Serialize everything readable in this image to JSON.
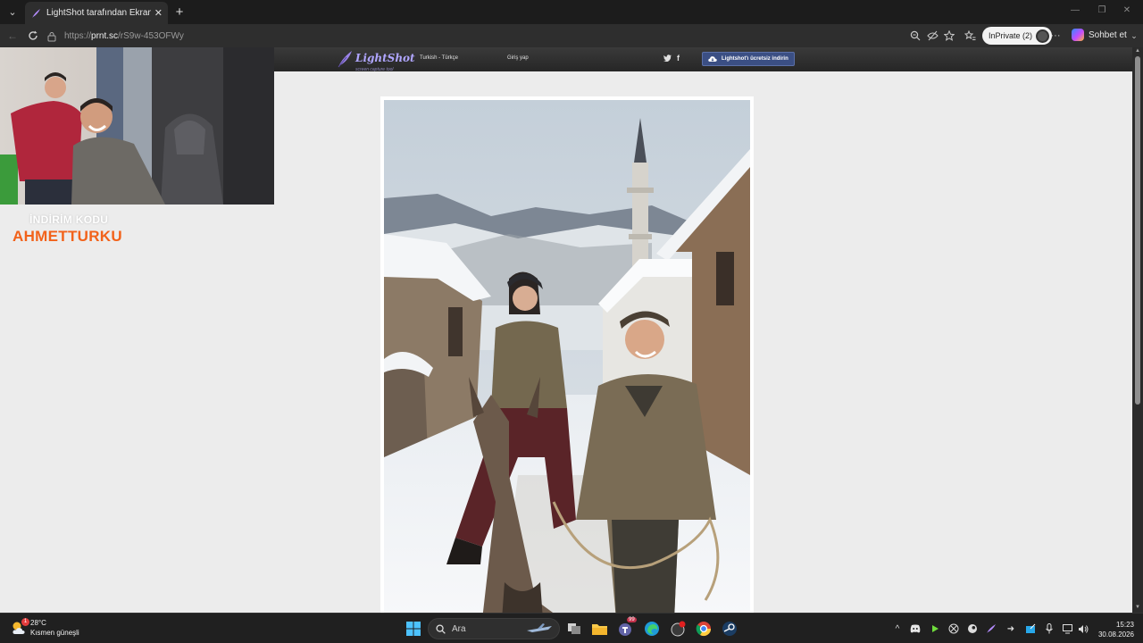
{
  "browser": {
    "tab": {
      "title": "LightShot tarafından Ekran Görünt",
      "close_glyph": "✕"
    },
    "new_tab_glyph": "+",
    "tab_list_glyph": "⌄",
    "window_controls": {
      "minimize": "—",
      "restore": "❐",
      "close": "✕"
    },
    "url": {
      "prefix": "https://",
      "domain": "prnt.sc",
      "path": "/rS9w-453OFWy"
    },
    "inprivate_label": "InPrivate (2)",
    "copilot_label": "Sohbet et",
    "more_glyph": "···"
  },
  "site": {
    "logo_text": "LightShot",
    "logo_subtitle": "screen capture tool",
    "language": "Turkish - Türkçe",
    "login": "Giriş yap",
    "twitter_glyph": "🐦",
    "facebook_glyph": "f",
    "download_button": "Lightshot'ı ücretsiz indirin"
  },
  "overlay": {
    "promo_label": "İNDİRİM KODU",
    "promo_code": "AHMETTURKU"
  },
  "taskbar": {
    "weather_temp": "28°C",
    "weather_desc": "Kısmen güneşli",
    "weather_badge": "1",
    "search_placeholder": "Ara",
    "teams_badge": "99",
    "time": "15:23",
    "date": "30.08.2026"
  },
  "colors": {
    "promo_orange": "#f2621a",
    "lightshot_purple": "#b0a6ff",
    "download_blue": "#3b4f84"
  }
}
